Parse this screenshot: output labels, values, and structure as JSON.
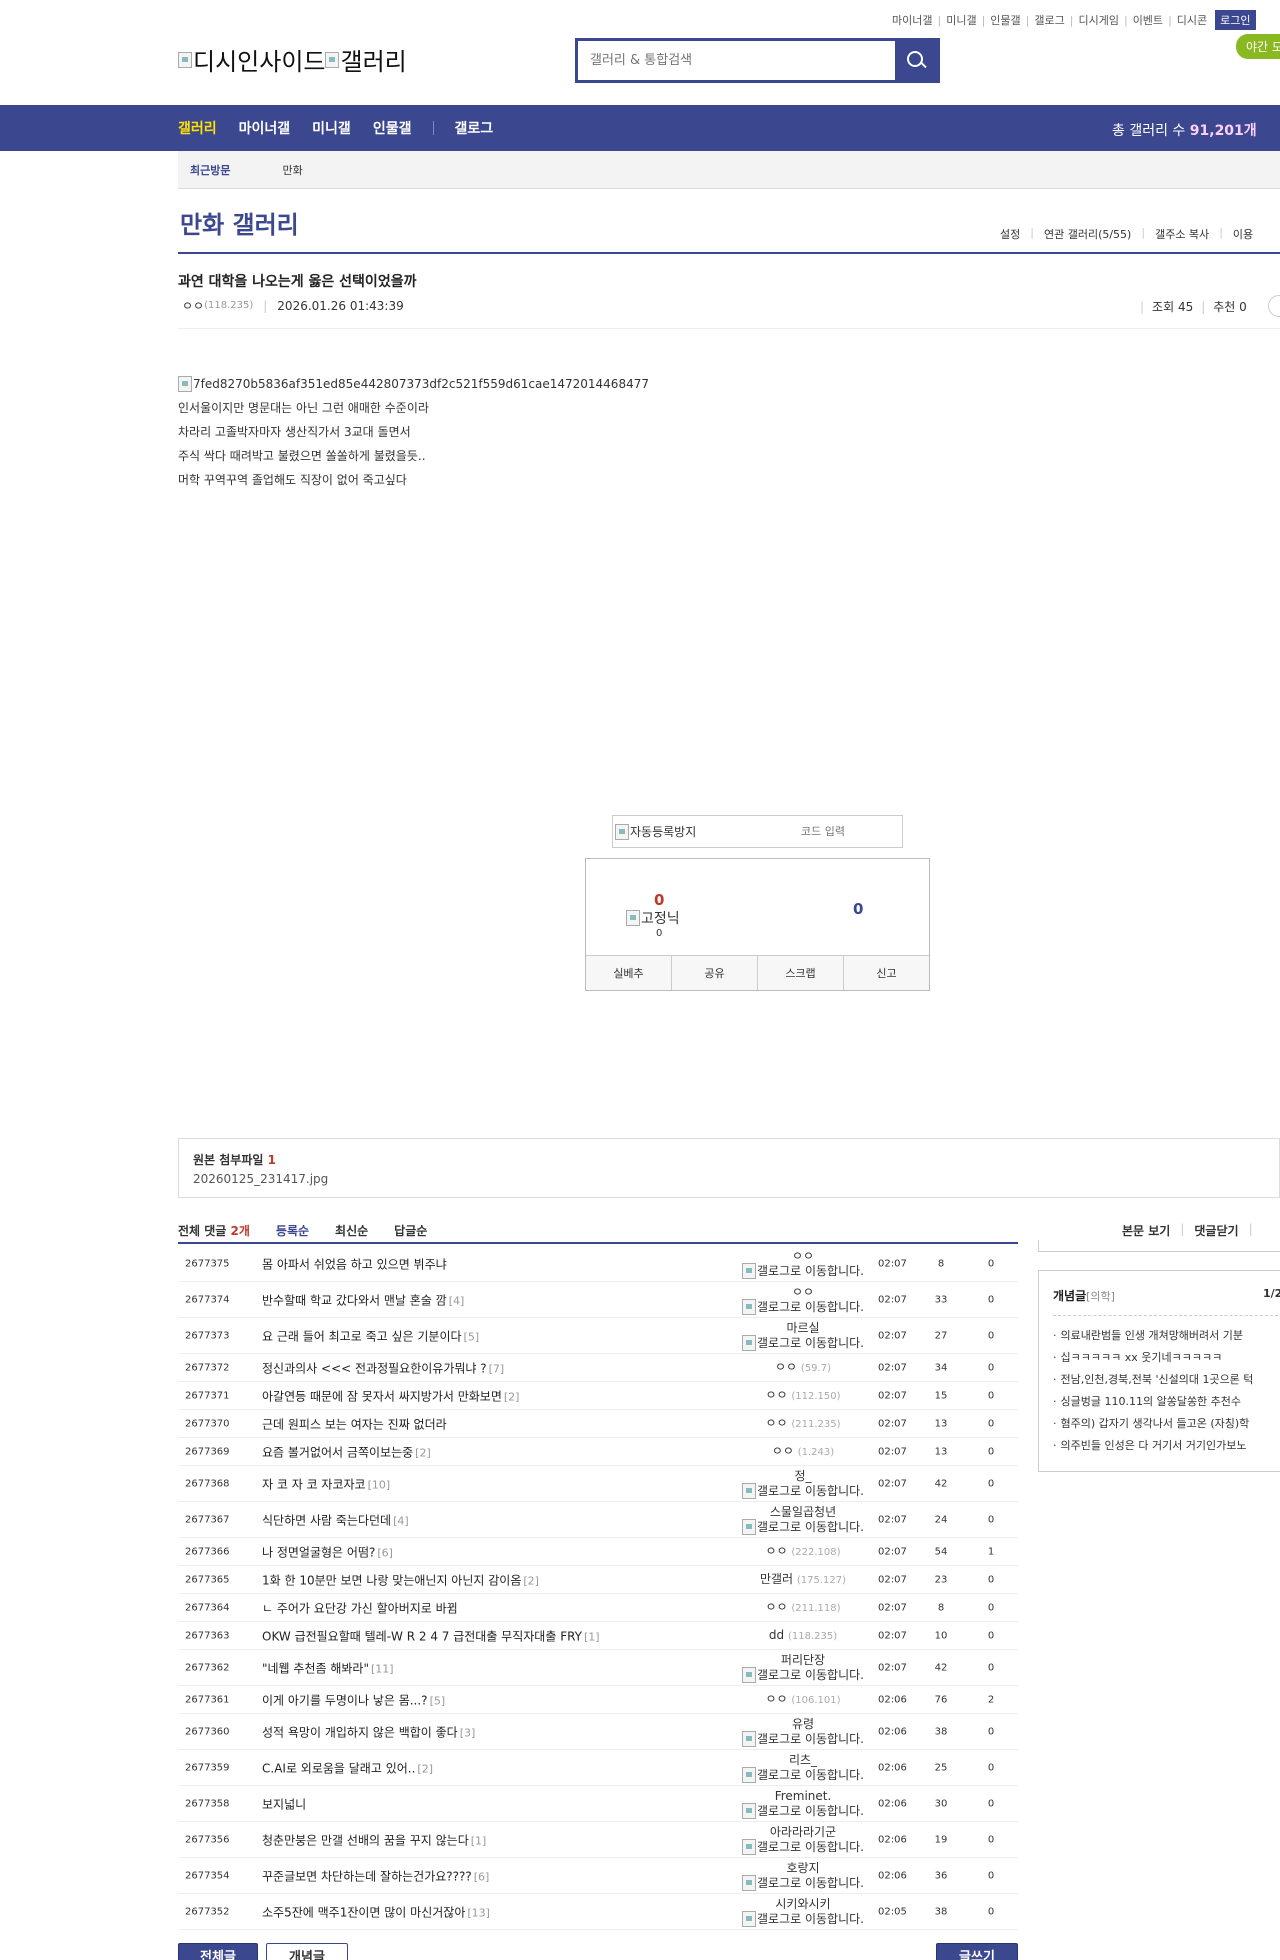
{
  "util_links": [
    "마이너갤",
    "미니갤",
    "인물갤",
    "갤로그",
    "디시게임",
    "이벤트",
    "디시콘"
  ],
  "login_label": "로그인",
  "night_label": "야간 모",
  "logo": {
    "site_alt": "디시인사이드",
    "gallery_alt": "갤러리"
  },
  "search": {
    "placeholder": "갤러리 & 통합검색"
  },
  "gnb": {
    "items": [
      "갤러리",
      "마이너갤",
      "미니갤",
      "인물갤"
    ],
    "gallog": "갤로그",
    "total_prefix": "총 갤러리 수 ",
    "total_count": "91,201개"
  },
  "recent": {
    "label": "최근방문",
    "items": [
      "만화"
    ]
  },
  "gallery": {
    "title": "만화 갤러리",
    "tools": [
      "설정",
      "연관 갤러리(5/55)",
      "갤주소 복사",
      "이용"
    ]
  },
  "post": {
    "title": "과연 대학을 나오는게 옳은 선택이었을까",
    "writer": "ㅇㅇ",
    "ip": "(118.235)",
    "date": "2026.01.26 01:43:39",
    "views_label": "조회 45",
    "rec_label": "추천 0",
    "image_alt": "7fed8270b5836af351ed85e442807373df2c521f559d61cae1472014468477",
    "lines": [
      "인서울이지만 명문대는 아닌 그런 애매한 수준이라",
      "차라리 고졸박자마자 생산직가서 3교대 돌면서",
      "주식 싹다 때려박고 불렸으면 쏠쏠하게 불렸을듯..",
      "머학 꾸역꾸역 졸업해도 직장이 없어 죽고싶다"
    ]
  },
  "captcha": {
    "image_alt": "자동등록방지",
    "placeholder": "코드 입력"
  },
  "recommend": {
    "up": "0",
    "fixed_alt": "고정닉",
    "fixed_count": "0",
    "down": "0",
    "buttons": [
      "실베추",
      "공유",
      "스크랩",
      "신고"
    ]
  },
  "attach": {
    "label": "원본 첨부파일 ",
    "count": "1",
    "file": "20260125_231417.jpg"
  },
  "comments": {
    "label": "전체 댓글 ",
    "count": "2개",
    "sorts": [
      "등록순",
      "최신순",
      "답글순"
    ],
    "tools": [
      "본문 보기",
      "댓글닫기"
    ]
  },
  "gallog_alt": "갤로그로 이동합니다.",
  "posts": [
    {
      "num": "2677375",
      "title": "몸 아파서 쉬었음 하고 있으면 뷔주냐",
      "rc": "",
      "writer": "ㅇㅇ",
      "ip": "",
      "gallog": true,
      "date": "02:07",
      "views": "8",
      "rec": "0"
    },
    {
      "num": "2677374",
      "title": "반수할때 학교 갔다와서 맨날 혼술 깜",
      "rc": "[4]",
      "writer": "ㅇㅇ",
      "ip": "",
      "gallog": true,
      "date": "02:07",
      "views": "33",
      "rec": "0"
    },
    {
      "num": "2677373",
      "title": "요 근래 들어 최고로 죽고 싶은 기분이다",
      "rc": "[5]",
      "writer": "마르실",
      "ip": "",
      "gallog": true,
      "date": "02:07",
      "views": "27",
      "rec": "0"
    },
    {
      "num": "2677372",
      "title": "정신과의사 <<< 전과정필요한이유가뭐냐 ?",
      "rc": "[7]",
      "writer": "ㅇㅇ",
      "ip": "(59.7)",
      "gallog": false,
      "date": "02:07",
      "views": "34",
      "rec": "0"
    },
    {
      "num": "2677371",
      "title": "아갈연등 때문에 잠 못자서 싸지방가서 만화보면",
      "rc": "[2]",
      "writer": "ㅇㅇ",
      "ip": "(112.150)",
      "gallog": false,
      "date": "02:07",
      "views": "15",
      "rec": "0"
    },
    {
      "num": "2677370",
      "title": "근데 원피스 보는 여자는 진짜 없더라",
      "rc": "",
      "writer": "ㅇㅇ",
      "ip": "(211.235)",
      "gallog": false,
      "date": "02:07",
      "views": "13",
      "rec": "0"
    },
    {
      "num": "2677369",
      "title": "요즘 볼거없어서 금쪽이보는중",
      "rc": "[2]",
      "writer": "ㅇㅇ",
      "ip": "(1.243)",
      "gallog": false,
      "date": "02:07",
      "views": "13",
      "rec": "0"
    },
    {
      "num": "2677368",
      "title": "자 코 자 코 자코자코",
      "rc": "[10]",
      "writer": "정_",
      "ip": "",
      "gallog": true,
      "date": "02:07",
      "views": "42",
      "rec": "0"
    },
    {
      "num": "2677367",
      "title": "식단하면 사람 죽는다던데",
      "rc": "[4]",
      "writer": "스물일곱청년",
      "ip": "",
      "gallog": true,
      "date": "02:07",
      "views": "24",
      "rec": "0"
    },
    {
      "num": "2677366",
      "title": "나 정면얼굴형은 어떰?",
      "rc": "[6]",
      "writer": "ㅇㅇ",
      "ip": "(222.108)",
      "gallog": false,
      "date": "02:07",
      "views": "54",
      "rec": "1"
    },
    {
      "num": "2677365",
      "title": "1화 한 10분만 보면 나랑 맞는애닌지 아닌지 감이옴",
      "rc": "[2]",
      "writer": "만갤러",
      "ip": "(175.127)",
      "gallog": false,
      "date": "02:07",
      "views": "23",
      "rec": "0"
    },
    {
      "num": "2677364",
      "title": "ㄴ 주어가 요단강 가신 할아버지로 바뀜",
      "rc": "",
      "writer": "ㅇㅇ",
      "ip": "(211.118)",
      "gallog": false,
      "date": "02:07",
      "views": "8",
      "rec": "0"
    },
    {
      "num": "2677363",
      "title": "OKW 급전필요할때 텔레-W R 2 4 7 급전대출 무직자대출 FRY",
      "rc": "[1]",
      "writer": "dd",
      "ip": "(118.235)",
      "gallog": false,
      "date": "02:07",
      "views": "10",
      "rec": "0"
    },
    {
      "num": "2677362",
      "title": "\"네웹 추천좀 해봐라\"",
      "rc": "[11]",
      "writer": "퍼리단장",
      "ip": "",
      "gallog": true,
      "date": "02:07",
      "views": "42",
      "rec": "0"
    },
    {
      "num": "2677361",
      "title": "이게 아기를 두명이나 낳은 몸...?",
      "rc": "[5]",
      "writer": "ㅇㅇ",
      "ip": "(106.101)",
      "gallog": false,
      "date": "02:06",
      "views": "76",
      "rec": "2"
    },
    {
      "num": "2677360",
      "title": "성적 욕망이 개입하지 않은 백합이 좋다",
      "rc": "[3]",
      "writer": "유령",
      "ip": "",
      "gallog": true,
      "date": "02:06",
      "views": "38",
      "rec": "0"
    },
    {
      "num": "2677359",
      "title": "C.AI로 외로움을 달래고 있어..",
      "rc": "[2]",
      "writer": "리츠_",
      "ip": "",
      "gallog": true,
      "date": "02:06",
      "views": "25",
      "rec": "0"
    },
    {
      "num": "2677358",
      "title": "보지넓니",
      "rc": "",
      "writer": "Freminet.",
      "ip": "",
      "gallog": true,
      "date": "02:06",
      "views": "30",
      "rec": "0"
    },
    {
      "num": "2677356",
      "title": "청춘만붕은 만갤 선배의 꿈을 꾸지 않는다",
      "rc": "[1]",
      "writer": "아라라라기군",
      "ip": "",
      "gallog": true,
      "date": "02:06",
      "views": "19",
      "rec": "0"
    },
    {
      "num": "2677354",
      "title": "꾸준글보면 차단하는데 잘하는건가요????",
      "rc": "[6]",
      "writer": "호랑지",
      "ip": "",
      "gallog": true,
      "date": "02:06",
      "views": "36",
      "rec": "0"
    },
    {
      "num": "2677352",
      "title": "소주5잔에 맥주1잔이면 많이 마신거잖아",
      "rc": "[13]",
      "writer": "시키와시키",
      "ip": "",
      "gallog": true,
      "date": "02:05",
      "views": "38",
      "rec": "0"
    }
  ],
  "side": {
    "title": "개념글",
    "sub": "[의학]",
    "page": "1/2",
    "items": [
      "의료내란범들 인생 개쳐망해버려서 기분",
      "십ㅋㅋㅋㅋㅋ xx 웃기네ㅋㅋㅋㅋㅋ",
      "전남,인천,경북,전북 '신설의대 1곳으론 턱",
      "싱글벙글 110.11의 알쏭달쏭한 추천수",
      "혐주의) 갑자기 생각나서 들고온 (자칭)학",
      "의주빈들 인성은 다 거기서 거기인가보노"
    ]
  },
  "bottom": {
    "all": "전체글",
    "concept": "개념글",
    "write": "글쓰기"
  }
}
